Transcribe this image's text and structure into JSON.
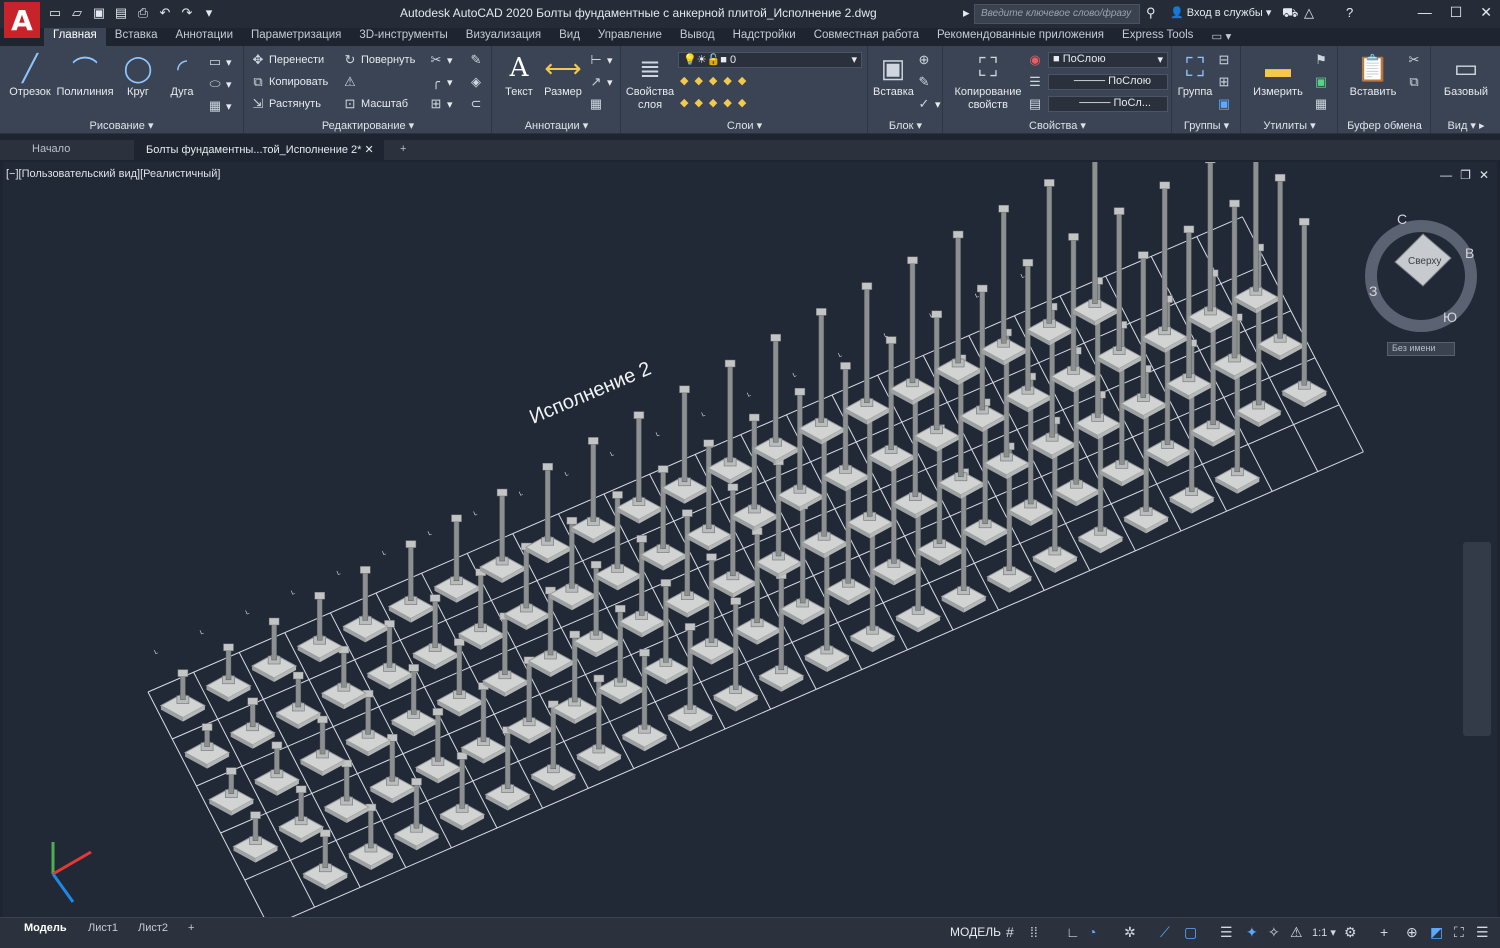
{
  "app": {
    "logo": "A",
    "title": "Autodesk AutoCAD 2020   Болты фундаментные с анкерной плитой_Исполнение 2.dwg",
    "search_placeholder": "Введите ключевое слово/фразу",
    "signin": "Вход в службы"
  },
  "qat": [
    "new-icon",
    "open-icon",
    "save-icon",
    "saveas-icon",
    "plot-icon",
    "undo-icon",
    "redo-icon"
  ],
  "ribbon_tabs": [
    "Главная",
    "Вставка",
    "Аннотации",
    "Параметризация",
    "3D-инструменты",
    "Визуализация",
    "Вид",
    "Управление",
    "Вывод",
    "Надстройки",
    "Совместная работа",
    "Рекомендованные приложения",
    "Express Tools"
  ],
  "panels": {
    "draw": {
      "label": "Рисование",
      "buttons": [
        "Отрезок",
        "Полилиния",
        "Круг",
        "Дуга"
      ]
    },
    "modify": {
      "label": "Редактирование",
      "buttons": [
        "Перенести",
        "Повернуть",
        "Копировать",
        "Растянуть",
        "Масштаб"
      ]
    },
    "annot": {
      "label": "Аннотации",
      "buttons": [
        "Текст",
        "Размер"
      ]
    },
    "layers": {
      "label": "Слои",
      "props_btn": "Свойства слоя",
      "layer_value": "0"
    },
    "block": {
      "label": "Блок",
      "insert": "Вставка"
    },
    "props": {
      "label": "Свойства",
      "matchprop": "Копирование свойств",
      "color": "ПоСлою",
      "linetype": "ПоСлою",
      "lineweight": "ПоСл..."
    },
    "groups": {
      "label": "Группы",
      "group": "Группа"
    },
    "utils": {
      "label": "Утилиты",
      "measure": "Измерить"
    },
    "clip": {
      "label": "Буфер обмена",
      "paste": "Вставить"
    },
    "view": {
      "label": "Вид",
      "base": "Базовый"
    }
  },
  "doc_tabs": [
    "Начало",
    "Болты фундаментны...той_Исполнение 2*"
  ],
  "viewport": {
    "label": "[−][Пользовательский вид][Реалистичный]",
    "scene_title": "Исполнение 2",
    "viewcube_face": "Сверху",
    "compass": [
      "С",
      "В",
      "Ю",
      "З"
    ],
    "ucs_name": "Без имени"
  },
  "layout_tabs": [
    "Модель",
    "Лист1",
    "Лист2"
  ],
  "status": {
    "model": "МОДЕЛЬ",
    "scale": "1:1"
  }
}
